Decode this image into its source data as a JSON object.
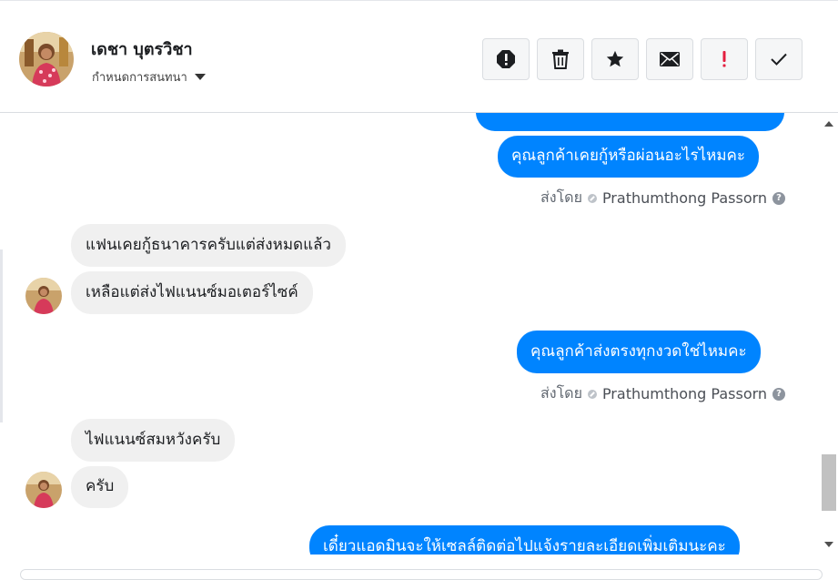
{
  "contact": {
    "name": "เดชา บุตรวิชา",
    "assign_label": "กำหนดการสนทนา"
  },
  "toolbar": {
    "buttons": [
      {
        "name": "spam",
        "icon": "alert-octagon-icon"
      },
      {
        "name": "delete",
        "icon": "trash-icon"
      },
      {
        "name": "star",
        "icon": "star-icon"
      },
      {
        "name": "mark-unread",
        "icon": "envelope-icon"
      },
      {
        "name": "important",
        "icon": "exclamation-icon"
      },
      {
        "name": "done",
        "icon": "check-icon"
      }
    ]
  },
  "messages": [
    {
      "side": "out",
      "text": "คุณลูกค้าเคยกู้หรือผ่อนอะไรไหมคะ"
    },
    {
      "side": "meta",
      "prefix": "ส่งโดย",
      "sender": "Prathumthong Passorn"
    },
    {
      "side": "in",
      "text": "แฟนเคยกู้ธนาคารครับแต่ส่งหมดแล้ว"
    },
    {
      "side": "in",
      "text": "เหลือแต่ส่งไฟแนนซ์มอเตอร์ไซค์"
    },
    {
      "side": "out",
      "text": "คุณลูกค้าส่งตรงทุกงวดใช่ไหมคะ"
    },
    {
      "side": "meta",
      "prefix": "ส่งโดย",
      "sender": "Prathumthong Passorn"
    },
    {
      "side": "in",
      "text": "ไฟแนนซ์สมหวังครับ"
    },
    {
      "side": "in",
      "text": "ครับ"
    },
    {
      "side": "out",
      "text": "เดี๋ยวแอดมินจะให้เซลล์ติดต่อไปแจ้งรายละเอียดเพิ่มเติมนะคะ"
    }
  ],
  "colors": {
    "outgoing_bubble": "#0084ff",
    "incoming_bubble": "#f0f0f0",
    "important_red": "#e41e3f"
  }
}
